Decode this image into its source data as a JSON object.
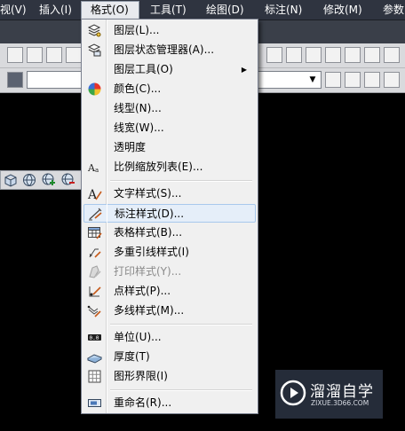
{
  "menubar": {
    "items": [
      {
        "label": "视(V)"
      },
      {
        "label": "插入(I)"
      },
      {
        "label": "格式(O)"
      },
      {
        "label": "工具(T)"
      },
      {
        "label": "绘图(D)"
      },
      {
        "label": "标注(N)"
      },
      {
        "label": "修改(M)"
      },
      {
        "label": "参数"
      }
    ],
    "active_index": 2
  },
  "format_menu": {
    "items": [
      {
        "label": "图层(L)...",
        "icon": "layer-icon"
      },
      {
        "label": "图层状态管理器(A)...",
        "icon": "layer-state-manager-icon"
      },
      {
        "label": "图层工具(O)",
        "icon": "none",
        "submenu": true
      },
      {
        "label": "颜色(C)...",
        "icon": "color-wheel-icon"
      },
      {
        "label": "线型(N)...",
        "icon": "none"
      },
      {
        "label": "线宽(W)...",
        "icon": "none"
      },
      {
        "label": "透明度",
        "icon": "none"
      },
      {
        "label": "比例缩放列表(E)...",
        "icon": "scale-list-icon"
      },
      {
        "label": "文字样式(S)...",
        "icon": "text-style-icon"
      },
      {
        "label": "标注样式(D)...",
        "icon": "dimension-style-icon",
        "highlighted": true
      },
      {
        "label": "表格样式(B)...",
        "icon": "table-style-icon"
      },
      {
        "label": "多重引线样式(I)",
        "icon": "multileader-style-icon"
      },
      {
        "label": "打印样式(Y)...",
        "icon": "plot-style-icon",
        "disabled": true
      },
      {
        "label": "点样式(P)...",
        "icon": "point-style-icon"
      },
      {
        "label": "多线样式(M)...",
        "icon": "multiline-style-icon"
      },
      {
        "label": "单位(U)...",
        "icon": "units-icon"
      },
      {
        "label": "厚度(T)",
        "icon": "thickness-icon"
      },
      {
        "label": "图形界限(I)",
        "icon": "drawing-limits-icon"
      },
      {
        "label": "重命名(R)...",
        "icon": "rename-icon"
      }
    ]
  },
  "watermark": {
    "text": "溜溜自学",
    "url": "ZIXUE.3D66.COM"
  },
  "colors": {
    "menubar_bg": "#2f3440",
    "menu_bg": "#f0f0f0",
    "highlight_bg": "#e5eef9",
    "highlight_border": "#a8c8ec",
    "canvas_bg": "#000000"
  }
}
